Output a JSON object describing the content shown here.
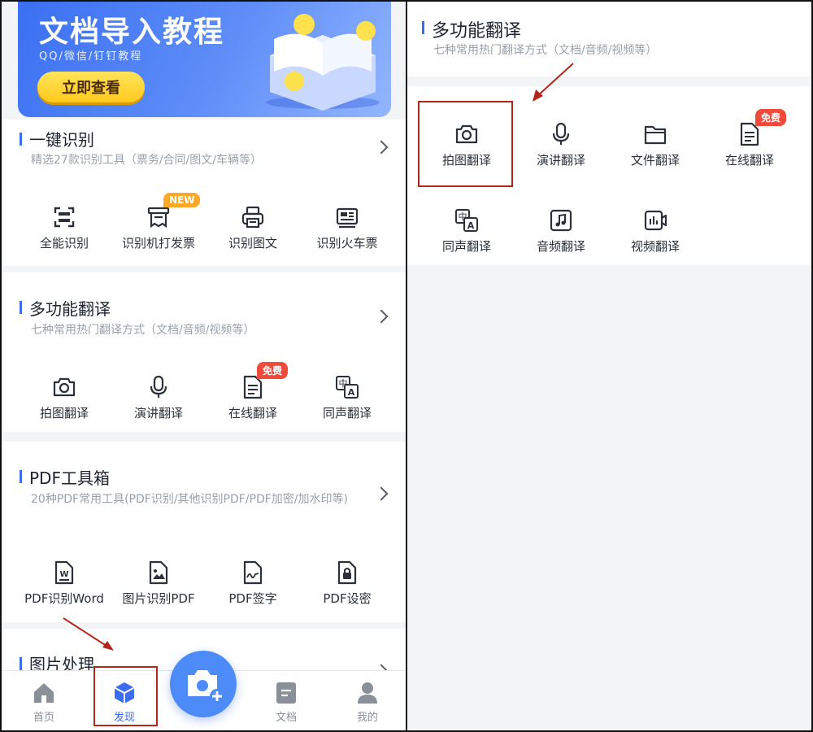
{
  "banner": {
    "title": "文档导入教程",
    "subtitle": "QQ/微信/钉钉教程",
    "button_label": "立即查看"
  },
  "recognition": {
    "title": "一键识别",
    "subtitle": "精选27款识别工具（票务/合同/图文/车辆等）",
    "items": [
      {
        "label": "全能识别",
        "icon": "scan-icon"
      },
      {
        "label": "识别机打发票",
        "icon": "invoice-icon",
        "badge": "NEW"
      },
      {
        "label": "识别图文",
        "icon": "printer-scan-icon"
      },
      {
        "label": "识别火车票",
        "icon": "ticket-icon"
      }
    ]
  },
  "translation": {
    "title": "多功能翻译",
    "subtitle": "七种常用热门翻译方式（文档/音频/视频等）",
    "items": [
      {
        "label": "拍图翻译",
        "icon": "camera-icon"
      },
      {
        "label": "演讲翻译",
        "icon": "microphone-icon"
      },
      {
        "label": "在线翻译",
        "icon": "document-icon",
        "badge": "免费"
      },
      {
        "label": "同声翻译",
        "icon": "zh-a-translate-icon"
      }
    ]
  },
  "pdf": {
    "title": "PDF工具箱",
    "subtitle": "20种PDF常用工具(PDF识别/其他识别PDF/PDF加密/加水印等)",
    "items": [
      {
        "label": "PDF识别Word",
        "icon": "word-doc-icon"
      },
      {
        "label": "图片识别PDF",
        "icon": "image-doc-icon"
      },
      {
        "label": "PDF签字",
        "icon": "signature-icon"
      },
      {
        "label": "PDF设密",
        "icon": "lock-doc-icon"
      }
    ]
  },
  "image_processing": {
    "title": "图片处理"
  },
  "tabbar": {
    "items": [
      {
        "label": "首页",
        "icon": "home-icon"
      },
      {
        "label": "发现",
        "icon": "discover-cube-icon",
        "active": true
      },
      {
        "label": "文档",
        "icon": "document-icon"
      },
      {
        "label": "我的",
        "icon": "user-icon"
      }
    ]
  },
  "right_panel": {
    "title": "多功能翻译",
    "subtitle": "七种常用热门翻译方式（文档/音频/视频等）",
    "items": [
      {
        "label": "拍图翻译",
        "icon": "camera-icon"
      },
      {
        "label": "演讲翻译",
        "icon": "microphone-icon"
      },
      {
        "label": "文件翻译",
        "icon": "folder-icon"
      },
      {
        "label": "在线翻译",
        "icon": "document-icon",
        "badge": "免费"
      },
      {
        "label": "同声翻译",
        "icon": "zh-a-translate-icon"
      },
      {
        "label": "音频翻译",
        "icon": "music-note-icon"
      },
      {
        "label": "视频翻译",
        "icon": "video-chart-icon"
      }
    ]
  },
  "colors": {
    "accent": "#3b6df2",
    "highlight_box": "#b3261e",
    "badge_new": "#ffa726",
    "badge_free": "#f24a3a"
  }
}
